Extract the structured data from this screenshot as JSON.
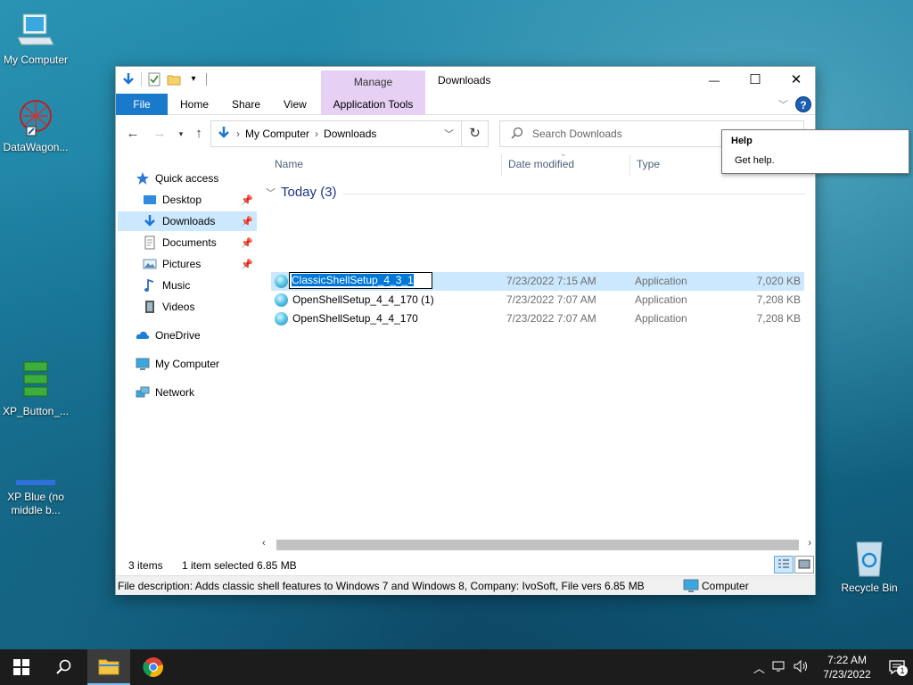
{
  "desktop": {
    "icons": [
      {
        "label": "My Computer"
      },
      {
        "label": "DataWagon..."
      },
      {
        "label": "XP_Button_..."
      },
      {
        "label": "XP Blue (no middle b..."
      },
      {
        "label": "Recycle Bin"
      }
    ]
  },
  "window": {
    "title": "Downloads",
    "manage_tab": "Manage",
    "app_tools_tab": "Application Tools",
    "tabs": [
      "File",
      "Home",
      "Share",
      "View"
    ],
    "minimize": "—",
    "maximize": "☐",
    "close": "✕",
    "help_glyph": "?"
  },
  "address": {
    "crumbs": [
      "My Computer",
      "Downloads"
    ],
    "search_placeholder": "Search Downloads"
  },
  "nav": {
    "quick_access": "Quick access",
    "items": [
      {
        "label": "Desktop",
        "pinned": true
      },
      {
        "label": "Downloads",
        "pinned": true
      },
      {
        "label": "Documents",
        "pinned": true
      },
      {
        "label": "Pictures",
        "pinned": true
      },
      {
        "label": "Music",
        "pinned": false
      },
      {
        "label": "Videos",
        "pinned": false
      }
    ],
    "onedrive": "OneDrive",
    "my_computer": "My Computer",
    "network": "Network"
  },
  "list": {
    "columns": [
      "Name",
      "Date modified",
      "Type"
    ],
    "group": "Today (3)",
    "rows": [
      {
        "name": "ClassicShellSetup_4_3_1",
        "date": "7/23/2022 7:15 AM",
        "type": "Application",
        "size": "7,020 KB"
      },
      {
        "name": "OpenShellSetup_4_4_170 (1)",
        "date": "7/23/2022 7:07 AM",
        "type": "Application",
        "size": "7,208 KB"
      },
      {
        "name": "OpenShellSetup_4_4_170",
        "date": "7/23/2022 7:07 AM",
        "type": "Application",
        "size": "7,208 KB"
      }
    ]
  },
  "status": {
    "count": "3 items",
    "selected": "1 item selected",
    "size": "6.85 MB"
  },
  "description": {
    "text": "File description: Adds classic shell features to Windows 7 and Windows 8, Company: IvoSoft, File versio",
    "size": "6.85 MB",
    "location": "Computer"
  },
  "tooltip": {
    "title": "Help",
    "body": "Get help."
  },
  "taskbar": {
    "time": "7:22 AM",
    "date": "7/23/2022",
    "notification_count": "1"
  }
}
